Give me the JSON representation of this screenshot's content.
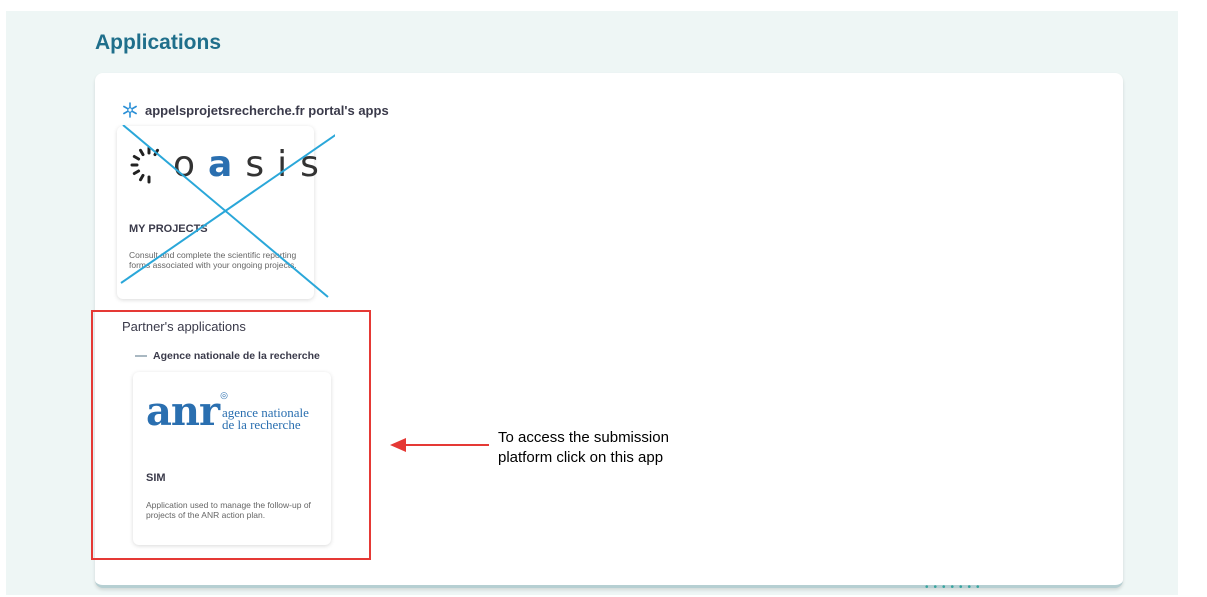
{
  "page_title": "Applications",
  "portal_section": {
    "title": "appelsprojetsrecherche.fr portal's apps",
    "icon": "snowflake-icon",
    "apps": [
      {
        "logo_text": "oasis",
        "logo_letters": [
          "o",
          "a",
          "s",
          "i",
          "s"
        ],
        "title": "MY PROJECTS",
        "description": "Consult and complete the scientific reporting forms associated with your ongoing projects.",
        "crossed_out": true
      }
    ]
  },
  "partner_section": {
    "title": "Partner's applications",
    "organization": "Agence nationale de la recherche",
    "apps": [
      {
        "logo_text": "anr",
        "logo_sub": "agence nationale de la recherche",
        "logo_sub_line1": "agence nationale",
        "logo_sub_line2": "de la recherche",
        "title": "SIM",
        "description": "Application used to manage the follow-up of projects of the ANR action plan."
      }
    ]
  },
  "callout": {
    "text": "To access the submission platform click on this app",
    "line1": "To access the submission",
    "line2": "platform click on this app"
  },
  "colors": {
    "accent": "#1f6f8b",
    "brand_blue": "#2a6fb0",
    "highlight_red": "#e53935",
    "cross_line": "#2aa7d9"
  }
}
